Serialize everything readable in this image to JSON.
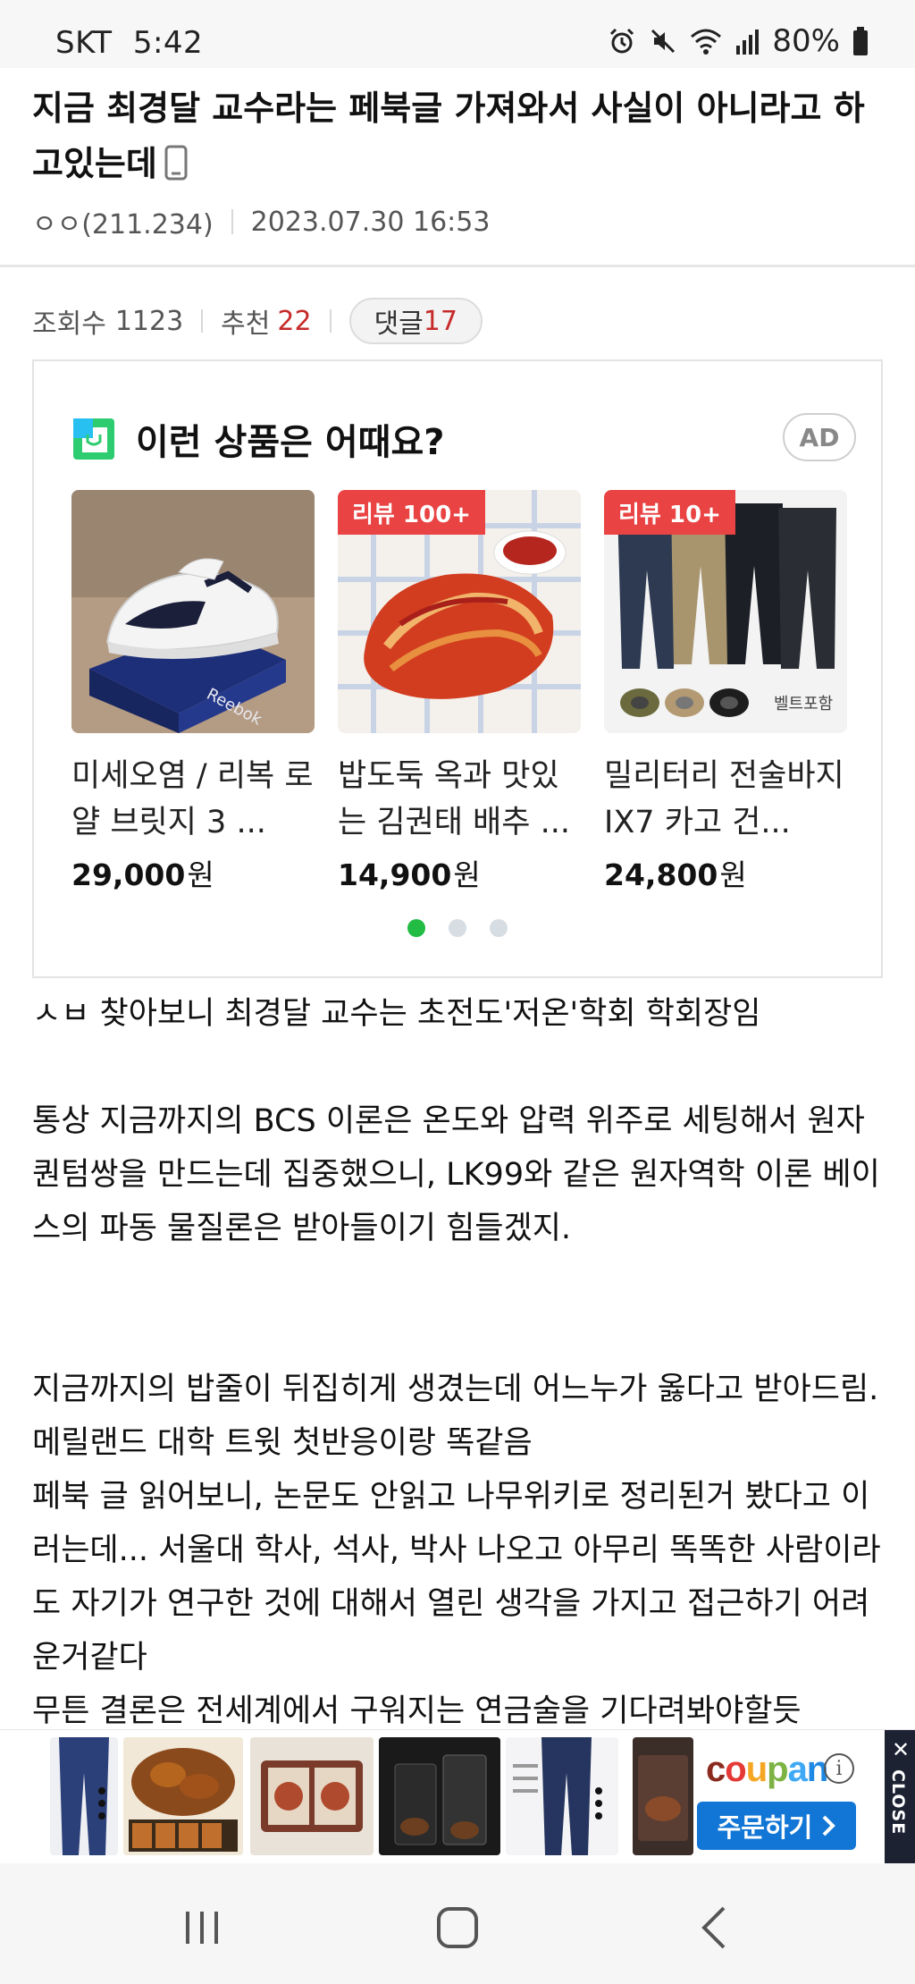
{
  "status_bar": {
    "carrier": "SKT",
    "time": "5:42",
    "battery": "80%",
    "icons": [
      "alarm-icon",
      "mute-icon",
      "wifi-icon",
      "signal-icon",
      "battery-icon"
    ]
  },
  "post": {
    "title": "지금 최경달 교수라는 페북글 가져와서 사실이 아니라고 하고있는데",
    "title_icon": "phone-icon",
    "author": "ㅇㅇ(211.234)",
    "datetime": "2023.07.30 16:53",
    "views_label": "조회수",
    "views": "1123",
    "recommend_label": "추천",
    "recommend": "22",
    "comments_label": "댓글",
    "comments": "17"
  },
  "ad_box": {
    "title": "이런 상품은 어때요?",
    "badge": "AD",
    "products": [
      {
        "name": "미세오염 / 리복 로얄 브릿지 3 ...",
        "price": "29,000",
        "unit": "원",
        "tag": ""
      },
      {
        "name": "밥도둑 옥과 맛있는 김권태 배추 ...",
        "price": "14,900",
        "unit": "원",
        "tag": "리뷰 100+"
      },
      {
        "name": "밀리터리 전술바지 IX7 카고 건...",
        "price": "24,800",
        "unit": "원",
        "tag": "리뷰 10+"
      }
    ],
    "image_texts": {
      "shoe_box": "Reebok",
      "belt_label": "벨트포함"
    },
    "dots_total": 3,
    "dots_active": 1
  },
  "article": {
    "lines": [
      "ㅅㅂ 찾아보니 최경달 교수는 초전도'저온'학회 학회장임",
      "",
      "통상 지금까지의 BCS 이론은 온도와 압력 위주로 세팅해서 원자 퀀텀쌍을 만드는데 집중했으니, LK99와 같은 원자역학 이론 베이스의 파동 물질론은 받아들이기 힘들겠지.",
      "",
      "",
      "지금까지의 밥줄이 뒤집히게 생겼는데 어느누가 옳다고 받아드림. 메릴랜드 대학 트윗 첫반응이랑 똑같음",
      "페북 글 읽어보니, 논문도 안읽고 나무위키로 정리된거 봤다고 이러는데... 서울대 학사, 석사, 박사 나오고 아무리 똑똑한 사람이라도 자기가 연구한 것에 대해서 열린 생각을 가지고 접근하기 어려운거같다",
      "무튼 결론은 전세계에서 구워지는 연금술을 기다려봐야할듯"
    ]
  },
  "banner": {
    "brand": "coupang",
    "order_label": "주문하기",
    "close_label": "CLOSE"
  },
  "colors": {
    "accent_red": "#c62a2a",
    "tag_red": "#e94343",
    "dot_active": "#22bb44",
    "coupang_blue": "#1276d6"
  }
}
